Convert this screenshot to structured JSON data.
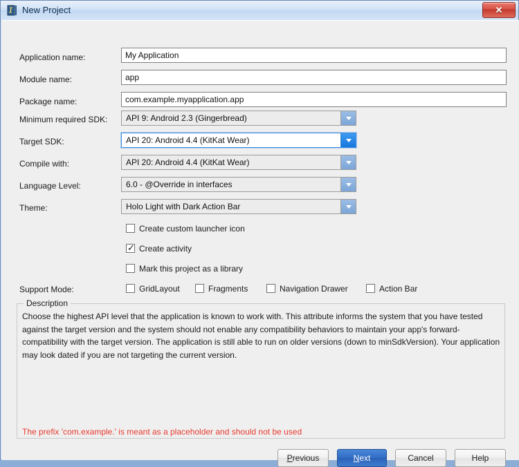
{
  "window": {
    "title": "New Project",
    "icon": "intellij-logo-icon",
    "close_label": "✕"
  },
  "form": {
    "fields": [
      {
        "label": "Application name:",
        "value": "My Application",
        "type": "text"
      },
      {
        "label": "Module name:",
        "value": "app",
        "type": "text"
      },
      {
        "label": "Package name:",
        "value": "com.example.myapplication.app",
        "type": "text"
      },
      {
        "label": "Minimum required SDK:",
        "value": "API 9: Android 2.3 (Gingerbread)",
        "type": "combo",
        "focused": false
      },
      {
        "label": "Target SDK:",
        "value": "API 20: Android 4.4 (KitKat Wear)",
        "type": "combo",
        "focused": true
      },
      {
        "label": "Compile with:",
        "value": "API 20: Android 4.4 (KitKat Wear)",
        "type": "combo",
        "focused": false
      },
      {
        "label": "Language Level:",
        "value": "6.0 - @Override in interfaces",
        "type": "combo",
        "focused": false
      },
      {
        "label": "Theme:",
        "value": "Holo Light with Dark Action Bar",
        "type": "combo",
        "focused": false
      }
    ],
    "options": [
      {
        "label": "Create custom launcher icon",
        "checked": false
      },
      {
        "label": "Create activity",
        "checked": true
      },
      {
        "label": "Mark this project as a library",
        "checked": false
      }
    ],
    "support_mode": {
      "label": "Support Mode:",
      "items": [
        {
          "label": "GridLayout",
          "checked": false
        },
        {
          "label": "Fragments",
          "checked": false
        },
        {
          "label": "Navigation Drawer",
          "checked": false
        },
        {
          "label": "Action Bar",
          "checked": false
        }
      ]
    }
  },
  "description": {
    "legend": "Description",
    "text": "Choose the highest API level that the application is known to work with. This attribute informs the system that you have tested against the target version and the system should not enable any compatibility behaviors to maintain your app's forward-compatibility with the target version. The application is still able to run on older versions (down to minSdkVersion). Your application may look dated if you are not targeting the current version."
  },
  "error_message": "The prefix 'com.example.' is meant as a placeholder and should not be used",
  "buttons": {
    "previous": {
      "prefix": "",
      "mnemonic": "P",
      "suffix": "revious"
    },
    "next": {
      "prefix": "",
      "mnemonic": "N",
      "suffix": "ext"
    },
    "cancel": "Cancel",
    "help": "Help"
  },
  "colors": {
    "accent": "#2f6cc4",
    "error": "#e8392e",
    "focus_border": "#3c8ade",
    "dialog_bg": "#efefef"
  }
}
